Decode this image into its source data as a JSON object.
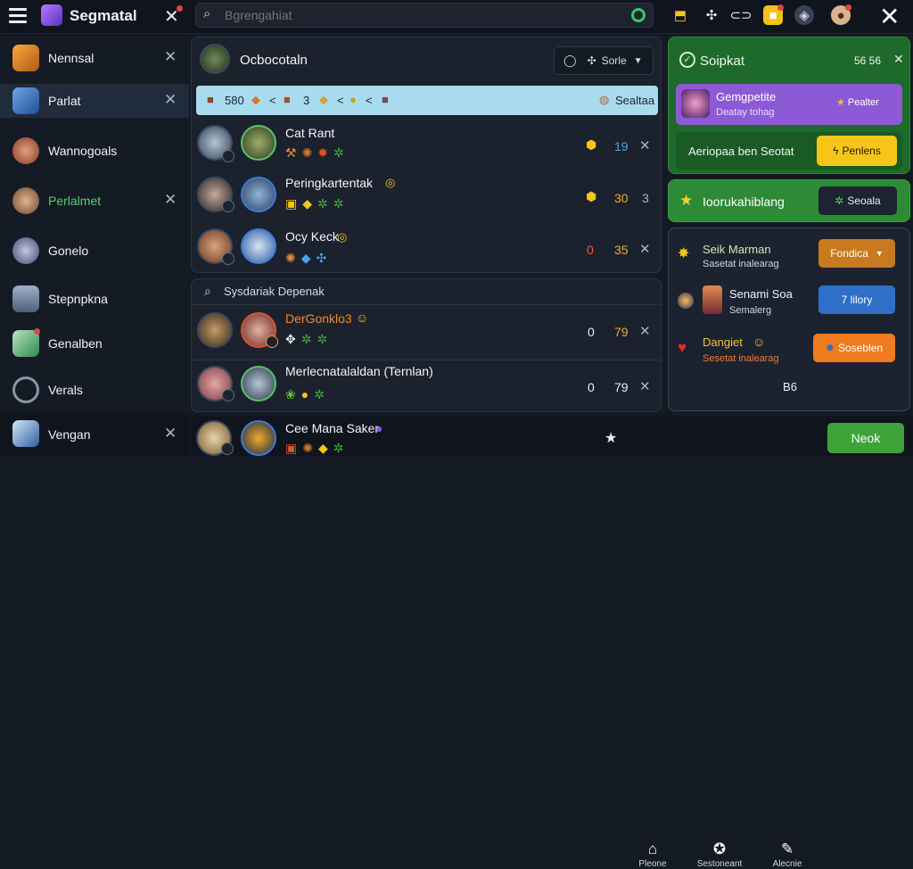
{
  "app": {
    "title": "Segmatal"
  },
  "search": {
    "placeholder": "Bgrengahiat"
  },
  "sidebar": {
    "items": [
      {
        "label": "Nennsal"
      },
      {
        "label": "Parlat"
      },
      {
        "label": "Wannogoals"
      },
      {
        "label": "Perlalmet"
      },
      {
        "label": "Gonelo"
      },
      {
        "label": "Stepnpkna"
      },
      {
        "label": "Genalben"
      },
      {
        "label": "Verals"
      },
      {
        "label": "Vengan"
      }
    ]
  },
  "party": {
    "title": "Ocbocotaln",
    "filter_label": "Sorle",
    "stats_bar": {
      "a": "580",
      "b": "<",
      "c": "3",
      "d": "<",
      "e": "<",
      "label": "Sealtaa"
    },
    "players": [
      {
        "name": "Cat Rant",
        "n1": "",
        "n2": "19"
      },
      {
        "name": "Peringkartentak",
        "n1": "",
        "n2": "30",
        "tail": "3"
      },
      {
        "name": "Ocy Keck",
        "n1": "0",
        "n2": "35"
      }
    ]
  },
  "lower": {
    "search_text": "Sysdariak Depenak",
    "players": [
      {
        "name": "DerGonklo3",
        "n1": "0",
        "n2": "79"
      },
      {
        "name": "Merlecnatalaldan (Ternlan)",
        "n1": "0",
        "n2": "79"
      }
    ]
  },
  "bottom_player": {
    "name": "Cee Mana Saker"
  },
  "right": {
    "header": {
      "title": "Soipkat",
      "counts": "56 56"
    },
    "card1": {
      "title": "Gemgpetite",
      "sub": "Deatay tohag",
      "btn": "Pealter"
    },
    "card2": {
      "text": "Aeriopaa ben Seotat",
      "btn": "Penlens"
    },
    "card3": {
      "title": "Ioorukahiblang",
      "btn": "Seoala"
    },
    "offers": [
      {
        "title": "Seik Marman",
        "sub": "Sasetat inalearag",
        "btn": "Fondica"
      },
      {
        "title": "Senami Soa",
        "sub": "Semalerg",
        "btn": "7 lilory"
      },
      {
        "title": "Dangiet",
        "sub": "Sesetat inalearag",
        "btn": "Soseblen"
      }
    ],
    "footer": "B6"
  },
  "bottom_nav": {
    "items": [
      "Pleone",
      "Sestoneant",
      "Alecnie"
    ],
    "cta": "Neok"
  },
  "colors": {
    "accent_green": "#39a23c",
    "accent_yellow": "#f5c518",
    "accent_orange": "#f07a1e",
    "accent_blue": "#2f6fc7",
    "accent_purple": "#8a4ee0"
  }
}
